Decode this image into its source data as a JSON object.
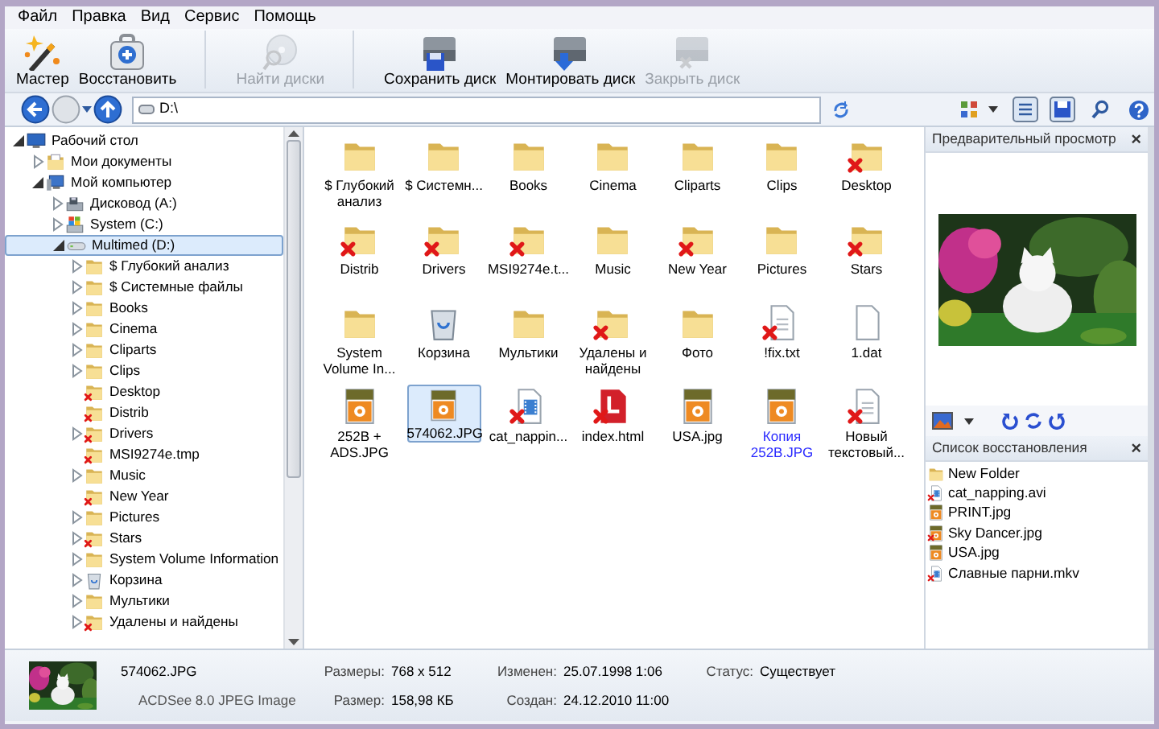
{
  "menu": [
    "Файл",
    "Правка",
    "Вид",
    "Сервис",
    "Помощь"
  ],
  "toolbar": [
    {
      "label": "Мастер",
      "kind": "wand",
      "disabled": false,
      "separator_before": false
    },
    {
      "label": "Восстановить",
      "kind": "medkit",
      "disabled": false,
      "separator_before": false
    },
    {
      "label": "Найти диски",
      "kind": "disc",
      "disabled": true,
      "separator_before": true
    },
    {
      "label": "Сохранить диск",
      "kind": "disk-save",
      "disabled": false,
      "separator_before": true
    },
    {
      "label": "Монтировать диск",
      "kind": "disk-mount",
      "disabled": false,
      "separator_before": false
    },
    {
      "label": "Закрыть диск",
      "kind": "disk-close",
      "disabled": true,
      "separator_before": false
    }
  ],
  "address": {
    "value": "D:\\"
  },
  "tree": [
    {
      "label": "Рабочий стол",
      "kind": "desktop",
      "expandable": true,
      "expanded": true,
      "selected": false,
      "deleted": false,
      "children": [
        {
          "label": "Мои документы",
          "kind": "docs",
          "expandable": true,
          "expanded": false,
          "selected": false,
          "deleted": false
        },
        {
          "label": "Мой компьютер",
          "kind": "computer",
          "expandable": true,
          "expanded": true,
          "selected": false,
          "deleted": false,
          "children": [
            {
              "label": "Дисковод (A:)",
              "kind": "floppy",
              "expandable": true,
              "expanded": false,
              "selected": false,
              "deleted": false
            },
            {
              "label": "System (C:)",
              "kind": "sysdrive",
              "expandable": true,
              "expanded": false,
              "selected": false,
              "deleted": false
            },
            {
              "label": "Multimed (D:)",
              "kind": "drive",
              "expandable": true,
              "expanded": true,
              "selected": true,
              "deleted": false,
              "children": [
                {
                  "label": "$ Глубокий анализ",
                  "kind": "folder",
                  "expandable": true,
                  "expanded": false,
                  "selected": false,
                  "deleted": false
                },
                {
                  "label": "$ Системные файлы",
                  "kind": "folder",
                  "expandable": true,
                  "expanded": false,
                  "selected": false,
                  "deleted": false
                },
                {
                  "label": "Books",
                  "kind": "folder",
                  "expandable": true,
                  "expanded": false,
                  "selected": false,
                  "deleted": false
                },
                {
                  "label": "Cinema",
                  "kind": "folder",
                  "expandable": true,
                  "expanded": false,
                  "selected": false,
                  "deleted": false
                },
                {
                  "label": "Cliparts",
                  "kind": "folder",
                  "expandable": true,
                  "expanded": false,
                  "selected": false,
                  "deleted": false
                },
                {
                  "label": "Clips",
                  "kind": "folder",
                  "expandable": true,
                  "expanded": false,
                  "selected": false,
                  "deleted": false
                },
                {
                  "label": "Desktop",
                  "kind": "folder",
                  "expandable": false,
                  "selected": false,
                  "deleted": true
                },
                {
                  "label": "Distrib",
                  "kind": "folder",
                  "expandable": false,
                  "selected": false,
                  "deleted": true
                },
                {
                  "label": "Drivers",
                  "kind": "folder",
                  "expandable": true,
                  "expanded": false,
                  "selected": false,
                  "deleted": true
                },
                {
                  "label": "MSI9274e.tmp",
                  "kind": "folder",
                  "expandable": false,
                  "selected": false,
                  "deleted": true
                },
                {
                  "label": "Music",
                  "kind": "folder",
                  "expandable": true,
                  "expanded": false,
                  "selected": false,
                  "deleted": false
                },
                {
                  "label": "New Year",
                  "kind": "folder",
                  "expandable": false,
                  "selected": false,
                  "deleted": true
                },
                {
                  "label": "Pictures",
                  "kind": "folder",
                  "expandable": true,
                  "expanded": false,
                  "selected": false,
                  "deleted": false
                },
                {
                  "label": "Stars",
                  "kind": "folder",
                  "expandable": true,
                  "expanded": false,
                  "selected": false,
                  "deleted": true
                },
                {
                  "label": "System Volume Information",
                  "kind": "folder",
                  "expandable": true,
                  "expanded": false,
                  "selected": false,
                  "deleted": false
                },
                {
                  "label": "Корзина",
                  "kind": "recycle",
                  "expandable": true,
                  "expanded": false,
                  "selected": false,
                  "deleted": false
                },
                {
                  "label": "Мультики",
                  "kind": "folder",
                  "expandable": true,
                  "expanded": false,
                  "selected": false,
                  "deleted": false
                },
                {
                  "label": "Удалены и найдены",
                  "kind": "folder",
                  "expandable": true,
                  "expanded": false,
                  "selected": false,
                  "deleted": true
                }
              ]
            }
          ]
        }
      ]
    }
  ],
  "files": [
    {
      "label": "$ Глубокий анализ",
      "kind": "folder",
      "deleted": false,
      "selected": false,
      "color": "#000000"
    },
    {
      "label": "$ Системн...",
      "kind": "folder",
      "deleted": false,
      "selected": false,
      "color": "#000000"
    },
    {
      "label": "Books",
      "kind": "folder",
      "deleted": false,
      "selected": false,
      "color": "#000000"
    },
    {
      "label": "Cinema",
      "kind": "folder",
      "deleted": false,
      "selected": false,
      "color": "#000000"
    },
    {
      "label": "Cliparts",
      "kind": "folder",
      "deleted": false,
      "selected": false,
      "color": "#000000"
    },
    {
      "label": "Clips",
      "kind": "folder",
      "deleted": false,
      "selected": false,
      "color": "#000000"
    },
    {
      "label": "Desktop",
      "kind": "folder",
      "deleted": true,
      "selected": false,
      "color": "#000000"
    },
    {
      "label": "Distrib",
      "kind": "folder",
      "deleted": true,
      "selected": false,
      "color": "#000000"
    },
    {
      "label": "Drivers",
      "kind": "folder",
      "deleted": true,
      "selected": false,
      "color": "#000000"
    },
    {
      "label": "MSI9274e.t...",
      "kind": "folder",
      "deleted": true,
      "selected": false,
      "color": "#000000"
    },
    {
      "label": "Music",
      "kind": "folder",
      "deleted": false,
      "selected": false,
      "color": "#000000"
    },
    {
      "label": "New Year",
      "kind": "folder",
      "deleted": true,
      "selected": false,
      "color": "#000000"
    },
    {
      "label": "Pictures",
      "kind": "folder",
      "deleted": false,
      "selected": false,
      "color": "#000000"
    },
    {
      "label": "Stars",
      "kind": "folder",
      "deleted": true,
      "selected": false,
      "color": "#000000"
    },
    {
      "label": "System Volume In...",
      "kind": "folder",
      "deleted": false,
      "selected": false,
      "color": "#000000"
    },
    {
      "label": "Корзина",
      "kind": "recycle",
      "deleted": false,
      "selected": false,
      "color": "#000000"
    },
    {
      "label": "Мультики",
      "kind": "folder",
      "deleted": false,
      "selected": false,
      "color": "#000000"
    },
    {
      "label": "Удалены и найдены",
      "kind": "folder",
      "deleted": true,
      "selected": false,
      "color": "#000000"
    },
    {
      "label": "Фото",
      "kind": "folder",
      "deleted": false,
      "selected": false,
      "color": "#000000"
    },
    {
      "label": "!fix.txt",
      "kind": "txt",
      "deleted": true,
      "selected": false,
      "color": "#000000"
    },
    {
      "label": "1.dat",
      "kind": "dat",
      "deleted": false,
      "selected": false,
      "color": "#000000"
    },
    {
      "label": "252B + ADS.JPG",
      "kind": "jpg",
      "deleted": false,
      "selected": false,
      "color": "#000000"
    },
    {
      "label": "574062.JPG",
      "kind": "jpg",
      "deleted": false,
      "selected": true,
      "color": "#000000"
    },
    {
      "label": "cat_nappin...",
      "kind": "video",
      "deleted": true,
      "selected": false,
      "color": "#000000"
    },
    {
      "label": "index.html",
      "kind": "html",
      "deleted": true,
      "selected": false,
      "color": "#000000"
    },
    {
      "label": "USA.jpg",
      "kind": "jpg",
      "deleted": false,
      "selected": false,
      "color": "#000000"
    },
    {
      "label": "Копия 252B.JPG",
      "kind": "jpg",
      "deleted": false,
      "selected": false,
      "color": "#2a2aff"
    },
    {
      "label": "Новый текстовый...",
      "kind": "txt",
      "deleted": true,
      "selected": false,
      "color": "#000000"
    }
  ],
  "preview": {
    "title": "Предварительный просмотр",
    "close": "×"
  },
  "recovery": {
    "title": "Список восстановления",
    "close": "×",
    "items": [
      {
        "label": "New Folder",
        "kind": "folder",
        "deleted": false
      },
      {
        "label": "cat_napping.avi",
        "kind": "video",
        "deleted": true
      },
      {
        "label": "PRINT.jpg",
        "kind": "jpg",
        "deleted": false
      },
      {
        "label": "Sky Dancer.jpg",
        "kind": "jpg",
        "deleted": true
      },
      {
        "label": "USA.jpg",
        "kind": "jpg",
        "deleted": false
      },
      {
        "label": "Славные парни.mkv",
        "kind": "video",
        "deleted": true
      }
    ]
  },
  "status": {
    "name": "574062.JPG",
    "type": "ACDSee 8.0 JPEG Image",
    "rows": [
      [
        {
          "label": "Размеры:",
          "value": "768 x 512"
        },
        {
          "label": "Изменен:",
          "value": "25.07.1998 1:06"
        },
        {
          "label": "Статус:",
          "value": "Существует"
        }
      ],
      [
        {
          "label": "Размер:",
          "value": "158,98 КБ"
        },
        {
          "label": "Создан:",
          "value": "24.12.2010 11:00"
        }
      ]
    ]
  }
}
